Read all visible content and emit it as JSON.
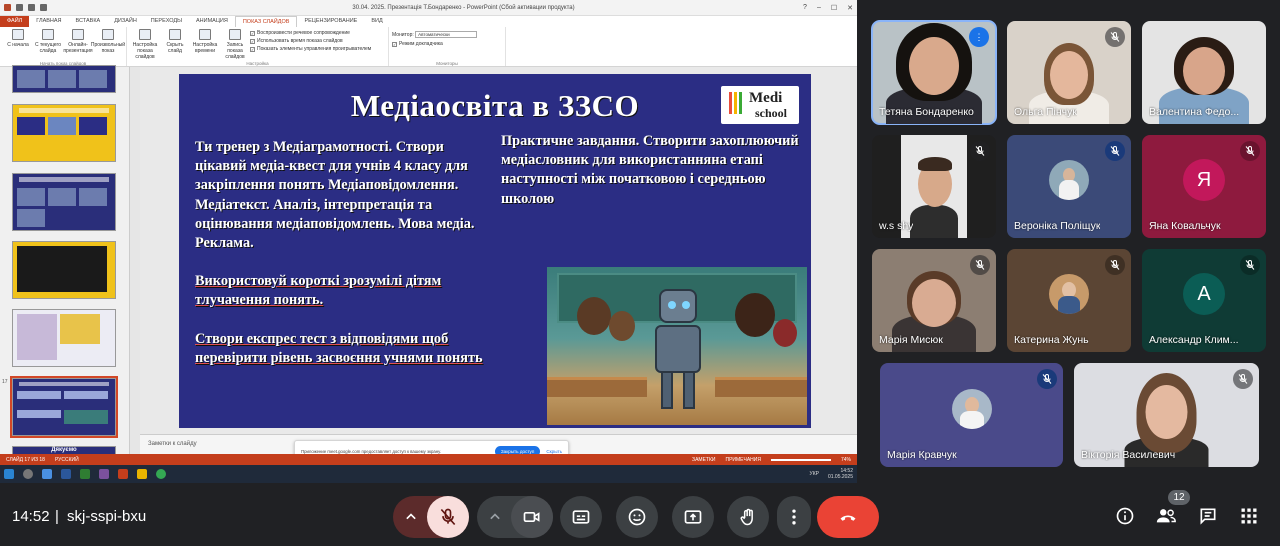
{
  "powerpoint": {
    "window_title": "30.04. 2025. Презентація Т.Бондаренко - PowerPoint (Сбой активации продукта)",
    "tabs": [
      "ФАЙЛ",
      "ГЛАВНАЯ",
      "ВСТАВКА",
      "ДИЗАЙН",
      "ПЕРЕХОДЫ",
      "АНИМАЦИЯ",
      "ПОКАЗ СЛАЙДОВ",
      "РЕЦЕНЗИРОВАНИЕ",
      "ВИД"
    ],
    "ribbon_buttons": [
      "С начала",
      "С текущего слайда",
      "Онлайн-презентация",
      "Произвольный показ",
      "Настройка показа слайдов",
      "Скрыть слайд",
      "Настройка времени",
      "Запись показа слайдов"
    ],
    "group_start": "Начать показ слайдов",
    "group_setup": "Настройка",
    "group_monitors": "Мониторы",
    "checkboxes": [
      "Воспроизвести речевое сопровождение",
      "Использовать время показа слайдов",
      "Показать элементы управления проигрывателем"
    ],
    "monitor_label": "Монитор:",
    "monitor_value": "Автоматически",
    "presenter_view": "Режим докладчика",
    "notes_placeholder": "Заметки к слайду",
    "status_left": "СЛАЙД 17 ИЗ 18",
    "status_lang": "РУССКИЙ",
    "status_notes": "ЗАМЕТКИ",
    "status_comments": "ПРИМЕЧАНИЯ",
    "zoom": "74%",
    "taskbar_time": "14:52",
    "taskbar_date": "01.05.2025",
    "taskbar_lang": "УКР",
    "thumb_number": "17",
    "thumb_next_title": "Дякуємо"
  },
  "slide": {
    "title": "Медіаосвіта в  ЗЗСО",
    "logo_line1": "Medi",
    "logo_line2": "school",
    "left_p1": "Ти тренер з Медіаграмотності. Створи цікавий медіа-квест для учнів 4 класу  для закріплення понять Медіаповідомлення.  Медіатекст. Аналіз, інтерпретація та оцінювання медіаповідомлень. Мова медіа. Реклама.",
    "left_p2": "Використовуй короткі зрозумілі дітям тлучачення понять.",
    "left_p3": "Створи експрес тест з відповідями щоб перевірити рівень  засвоєння учнями понять",
    "right_text": "Практичне завдання. Створити захоплюючий  медіасловник для використанняна етапі наступності між початковою і середньою школою"
  },
  "toast": {
    "message": "Приложение meet.google.com предоставляет доступ к вашему экрану.",
    "stop_button": "Закрыть доступ",
    "hide_link": "Скрыть"
  },
  "participants": [
    {
      "name": "Тетяна Бондаренко",
      "speaking": true
    },
    {
      "name": "Ольга Пінчук"
    },
    {
      "name": "Валентина Федо..."
    },
    {
      "name": "w.s shy"
    },
    {
      "name": "Вероніка Поліщук"
    },
    {
      "name": "Яна Ковальчук",
      "initial": "Я",
      "color": "#c2185b"
    },
    {
      "name": "Марія Мисюк"
    },
    {
      "name": "Катерина Жунь"
    },
    {
      "name": "Александр Клим...",
      "initial": "А",
      "color": "#0b5d55"
    },
    {
      "name": "Марія Кравчук"
    },
    {
      "name": "Вікторія Василевич"
    }
  ],
  "meeting": {
    "time": "14:52",
    "separator": "|",
    "code": "skj-sspi-bxu",
    "participant_count": "12"
  },
  "colors": {
    "slide_bg": "#2b2d84",
    "ppt_accent": "#c43e1c",
    "leave_red": "#ea4335",
    "meet_bg": "#202124"
  }
}
